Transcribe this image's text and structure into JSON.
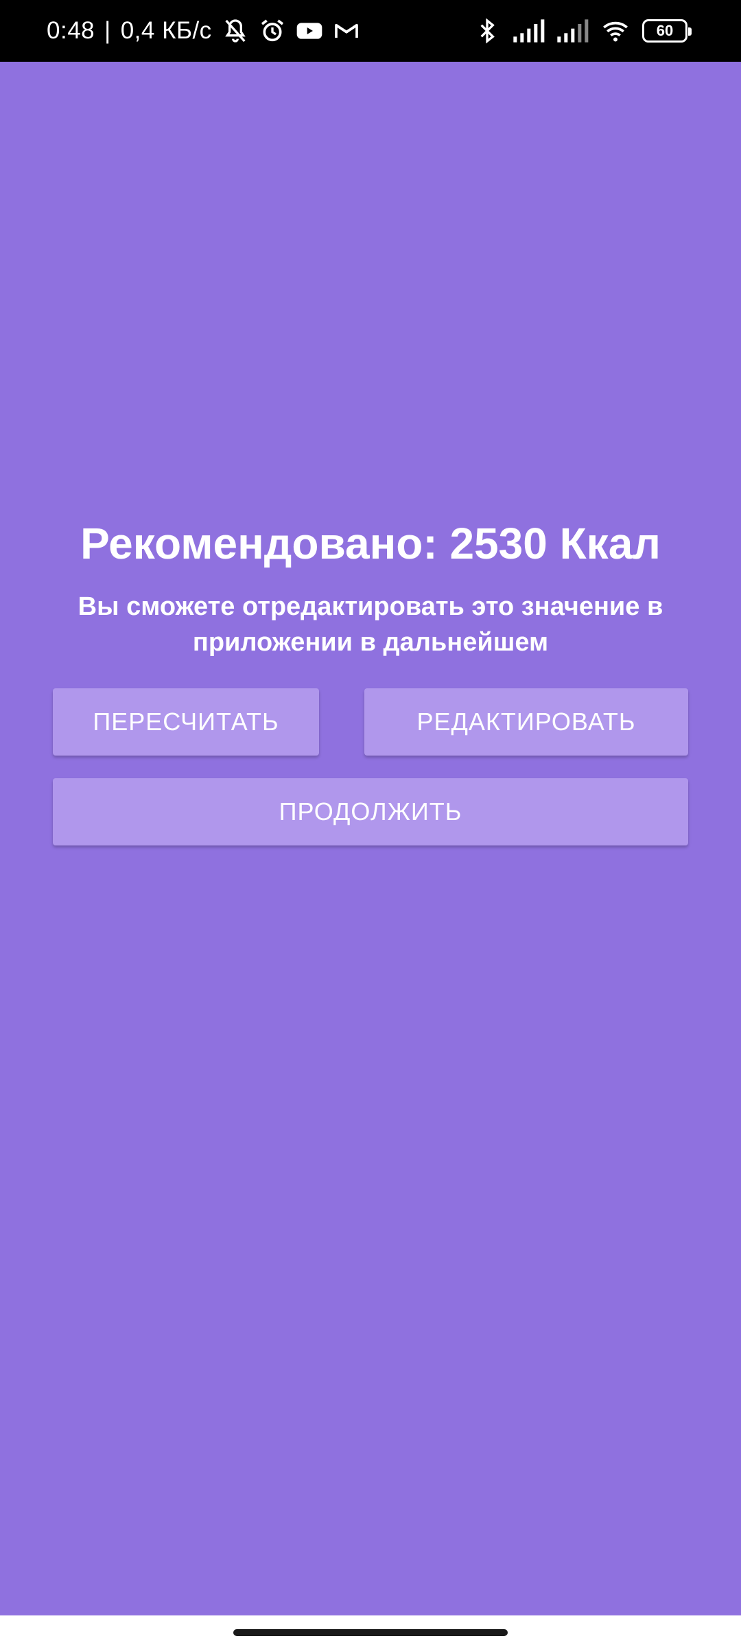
{
  "status_bar": {
    "time": "0:48",
    "separator": "|",
    "network_speed": "0,4 КБ/с",
    "left_icons": [
      "bell-off-icon",
      "alarm-icon",
      "youtube-icon",
      "gmail-icon"
    ],
    "right_icons": [
      "bluetooth-icon",
      "signal-icon",
      "signal-icon",
      "wifi-icon"
    ],
    "battery_level": "60"
  },
  "main": {
    "title": "Рекомендовано: 2530 Ккал",
    "subtitle": "Вы сможете отредактировать это значение в приложении в дальнейшем",
    "buttons": {
      "recalculate": "ПЕРЕСЧИТАТЬ",
      "edit": "РЕДАКТИРОВАТЬ",
      "continue": "ПРОДОЛЖИТЬ"
    }
  },
  "colors": {
    "background": "#8f71df",
    "button": "#b097ec",
    "text": "#ffffff",
    "status_bar": "#000000"
  }
}
